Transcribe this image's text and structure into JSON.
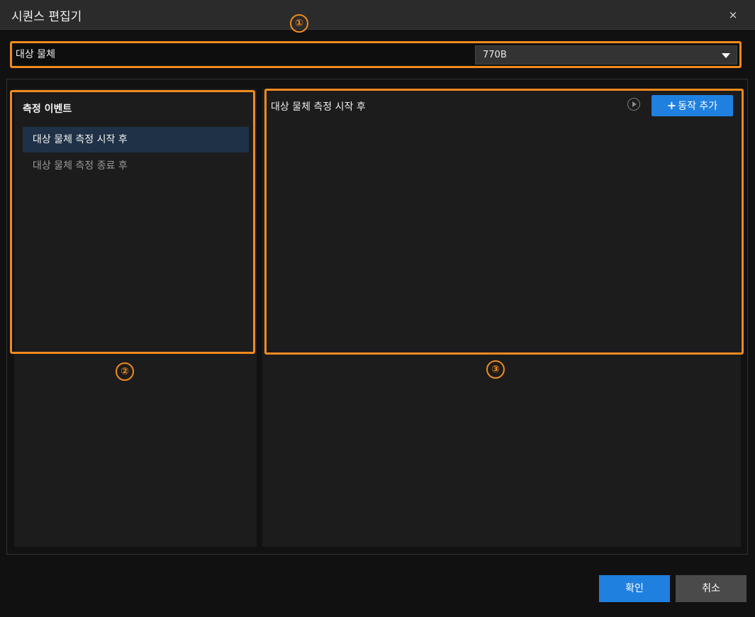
{
  "window": {
    "title": "시퀀스 편집기",
    "close_label": "×"
  },
  "markers": [
    "①",
    "②",
    "③"
  ],
  "target": {
    "label": "대상 물체",
    "selected": "770B"
  },
  "events": {
    "title": "측정 이벤트",
    "items": [
      {
        "label": "대상 물체 측정 시작 후",
        "active": true
      },
      {
        "label": "대상 물체 측정 종료 후",
        "active": false
      }
    ]
  },
  "actions": {
    "title": "대상 물체 측정 시작 후",
    "add_button": "동작 추가",
    "add_icon": "+",
    "play_icon": "play-icon"
  },
  "footer": {
    "ok": "확인",
    "cancel": "취소"
  },
  "colors": {
    "accent": "#1f80e0",
    "highlight": "#f08a1f",
    "active_item": "#1f3146"
  }
}
